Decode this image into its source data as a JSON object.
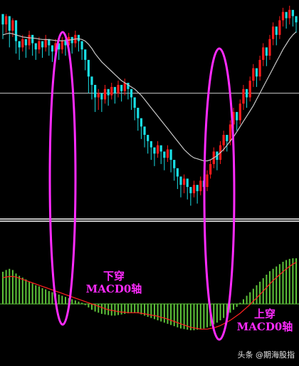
{
  "annotations": {
    "cross_down": [
      "下穿",
      "MACD0轴"
    ],
    "cross_up": [
      "上穿",
      "MACD0轴"
    ]
  },
  "watermark": "头条 @期海股指",
  "colors": {
    "background": "#000000",
    "bull_candle": "#ff1a1a",
    "bear_candle": "#19e0e6",
    "moving_average": "#c8c8c8",
    "macd_histogram": "#5ec43a",
    "signal_line": "#ff2020",
    "highlight_ellipse": "#ff2bff",
    "reference_line": "#ffffff"
  },
  "chart_data": [
    {
      "type": "candlestick",
      "title": "",
      "series": [
        {
          "name": "",
          "kind": "ohlc",
          "values": [
            [
              96,
              91,
              84,
              92
            ],
            [
              91,
              95,
              87,
              96
            ],
            [
              95,
              88,
              80,
              89
            ],
            [
              88,
              93,
              85,
              94
            ],
            [
              93,
              83,
              77,
              84
            ],
            [
              83,
              80,
              74,
              82
            ],
            [
              80,
              84,
              78,
              86
            ],
            [
              84,
              81,
              75,
              83
            ],
            [
              81,
              86,
              79,
              88
            ],
            [
              86,
              82,
              76,
              84
            ],
            [
              82,
              79,
              74,
              81
            ],
            [
              79,
              83,
              77,
              85
            ],
            [
              83,
              80,
              75,
              82
            ],
            [
              80,
              84,
              78,
              86
            ],
            [
              84,
              81,
              76,
              83
            ],
            [
              81,
              78,
              73,
              80
            ],
            [
              78,
              82,
              76,
              84
            ],
            [
              82,
              79,
              74,
              81
            ],
            [
              79,
              83,
              77,
              85
            ],
            [
              83,
              81,
              76,
              84
            ],
            [
              81,
              85,
              79,
              87
            ],
            [
              85,
              82,
              77,
              84
            ],
            [
              82,
              86,
              80,
              88
            ],
            [
              86,
              83,
              78,
              85
            ],
            [
              83,
              79,
              74,
              81
            ],
            [
              79,
              74,
              69,
              76
            ],
            [
              74,
              66,
              58,
              68
            ],
            [
              66,
              62,
              55,
              64
            ],
            [
              62,
              56,
              49,
              58
            ],
            [
              56,
              58,
              50,
              60
            ],
            [
              58,
              55,
              49,
              57
            ],
            [
              55,
              60,
              53,
              62
            ],
            [
              60,
              57,
              52,
              59
            ],
            [
              57,
              61,
              55,
              63
            ],
            [
              61,
              58,
              53,
              60
            ],
            [
              58,
              62,
              56,
              64
            ],
            [
              62,
              59,
              54,
              61
            ],
            [
              59,
              63,
              57,
              65
            ],
            [
              63,
              60,
              55,
              62
            ],
            [
              60,
              56,
              50,
              58
            ],
            [
              56,
              51,
              45,
              53
            ],
            [
              51,
              46,
              40,
              48
            ],
            [
              46,
              42,
              36,
              44
            ],
            [
              42,
              38,
              32,
              40
            ],
            [
              38,
              35,
              29,
              37
            ],
            [
              35,
              32,
              26,
              34
            ],
            [
              32,
              29,
              23,
              31
            ],
            [
              29,
              33,
              27,
              35
            ],
            [
              33,
              30,
              24,
              32
            ],
            [
              30,
              27,
              21,
              29
            ],
            [
              27,
              31,
              25,
              33
            ],
            [
              31,
              26,
              20,
              28
            ],
            [
              26,
              22,
              16,
              24
            ],
            [
              22,
              18,
              12,
              20
            ],
            [
              18,
              14,
              8,
              16
            ],
            [
              14,
              17,
              10,
              19
            ],
            [
              17,
              13,
              7,
              15
            ],
            [
              13,
              10,
              4,
              12
            ],
            [
              10,
              14,
              8,
              16
            ],
            [
              14,
              11,
              5,
              13
            ],
            [
              11,
              16,
              9,
              18
            ],
            [
              16,
              13,
              8,
              15
            ],
            [
              13,
              19,
              11,
              21
            ],
            [
              19,
              24,
              17,
              26
            ],
            [
              24,
              30,
              22,
              32
            ],
            [
              30,
              26,
              21,
              28
            ],
            [
              26,
              33,
              24,
              35
            ],
            [
              33,
              38,
              30,
              40
            ],
            [
              38,
              35,
              30,
              37
            ],
            [
              35,
              43,
              33,
              45
            ],
            [
              43,
              49,
              41,
              51
            ],
            [
              49,
              45,
              40,
              47
            ],
            [
              45,
              53,
              43,
              55
            ],
            [
              53,
              60,
              50,
              62
            ],
            [
              60,
              56,
              51,
              58
            ],
            [
              56,
              64,
              54,
              66
            ],
            [
              64,
              70,
              61,
              72
            ],
            [
              70,
              66,
              61,
              68
            ],
            [
              66,
              74,
              64,
              76
            ],
            [
              74,
              80,
              71,
              82
            ],
            [
              80,
              76,
              71,
              78
            ],
            [
              76,
              84,
              74,
              86
            ],
            [
              84,
              90,
              81,
              92
            ],
            [
              90,
              86,
              81,
              88
            ],
            [
              86,
              93,
              84,
              95
            ],
            [
              93,
              97,
              90,
              99
            ],
            [
              97,
              94,
              89,
              96
            ],
            [
              94,
              98,
              91,
              100
            ],
            [
              98,
              95,
              90,
              97
            ],
            [
              95,
              92,
              87,
              94
            ]
          ]
        },
        {
          "name": "",
          "kind": "line",
          "values": [
            86,
            86.5,
            86.8,
            86.5,
            86,
            85.5,
            85,
            84.8,
            84.6,
            84.5,
            84.3,
            84,
            83.8,
            83.8,
            83.7,
            83.5,
            83.3,
            83.2,
            83.2,
            83.3,
            83.5,
            83.7,
            84,
            84.1,
            83.8,
            83,
            81.5,
            79.5,
            77,
            75,
            73,
            71.5,
            70,
            68.5,
            67,
            65.5,
            64,
            63,
            62,
            61,
            60,
            58.5,
            57,
            55,
            53,
            51,
            49,
            47,
            45,
            43,
            41,
            39,
            37,
            35,
            33,
            31,
            29.5,
            28,
            27,
            26.5,
            26,
            25.5,
            25.5,
            26,
            27,
            28,
            29.5,
            31,
            33,
            35,
            37,
            39.5,
            42,
            44.5,
            47,
            49.5,
            52,
            55,
            58,
            61,
            64,
            67,
            70,
            73,
            76,
            79,
            81.5,
            84,
            86,
            87.5
          ]
        }
      ],
      "reference_lines": [
        58
      ]
    },
    {
      "type": "bar",
      "title": "",
      "series": [
        {
          "name": "",
          "kind": "histogram",
          "values": [
            0.55,
            0.58,
            0.6,
            0.58,
            0.52,
            0.48,
            0.45,
            0.42,
            0.38,
            0.35,
            0.32,
            0.3,
            0.27,
            0.25,
            0.22,
            0.2,
            0.18,
            0.16,
            0.14,
            0.12,
            0.1,
            0.08,
            0.06,
            0.04,
            0.02,
            -0.02,
            -0.06,
            -0.1,
            -0.13,
            -0.15,
            -0.17,
            -0.18,
            -0.19,
            -0.2,
            -0.2,
            -0.19,
            -0.18,
            -0.17,
            -0.16,
            -0.15,
            -0.15,
            -0.16,
            -0.18,
            -0.2,
            -0.22,
            -0.24,
            -0.26,
            -0.28,
            -0.3,
            -0.32,
            -0.34,
            -0.36,
            -0.38,
            -0.4,
            -0.42,
            -0.43,
            -0.44,
            -0.45,
            -0.45,
            -0.44,
            -0.43,
            -0.42,
            -0.4,
            -0.38,
            -0.35,
            -0.32,
            -0.28,
            -0.24,
            -0.2,
            -0.15,
            -0.1,
            -0.05,
            0.02,
            0.08,
            0.14,
            0.2,
            0.26,
            0.32,
            0.38,
            0.44,
            0.5,
            0.56,
            0.6,
            0.64,
            0.68,
            0.72,
            0.75,
            0.77,
            0.78,
            0.78
          ]
        },
        {
          "name": "",
          "kind": "line",
          "values": [
            0.45,
            0.46,
            0.47,
            0.47,
            0.46,
            0.44,
            0.42,
            0.4,
            0.38,
            0.36,
            0.34,
            0.32,
            0.3,
            0.28,
            0.26,
            0.24,
            0.22,
            0.2,
            0.18,
            0.16,
            0.14,
            0.12,
            0.1,
            0.08,
            0.06,
            0.04,
            0.02,
            0,
            -0.02,
            -0.04,
            -0.06,
            -0.08,
            -0.1,
            -0.11,
            -0.12,
            -0.13,
            -0.14,
            -0.14,
            -0.15,
            -0.15,
            -0.15,
            -0.15,
            -0.16,
            -0.17,
            -0.18,
            -0.19,
            -0.2,
            -0.21,
            -0.23,
            -0.24,
            -0.26,
            -0.28,
            -0.3,
            -0.32,
            -0.34,
            -0.36,
            -0.38,
            -0.4,
            -0.41,
            -0.42,
            -0.43,
            -0.43,
            -0.43,
            -0.42,
            -0.41,
            -0.39,
            -0.37,
            -0.34,
            -0.31,
            -0.28,
            -0.24,
            -0.2,
            -0.16,
            -0.11,
            -0.06,
            -0.01,
            0.05,
            0.1,
            0.16,
            0.22,
            0.28,
            0.34,
            0.4,
            0.45,
            0.5,
            0.55,
            0.6,
            0.64,
            0.68,
            0.71
          ]
        }
      ],
      "zero_line": 0
    }
  ]
}
